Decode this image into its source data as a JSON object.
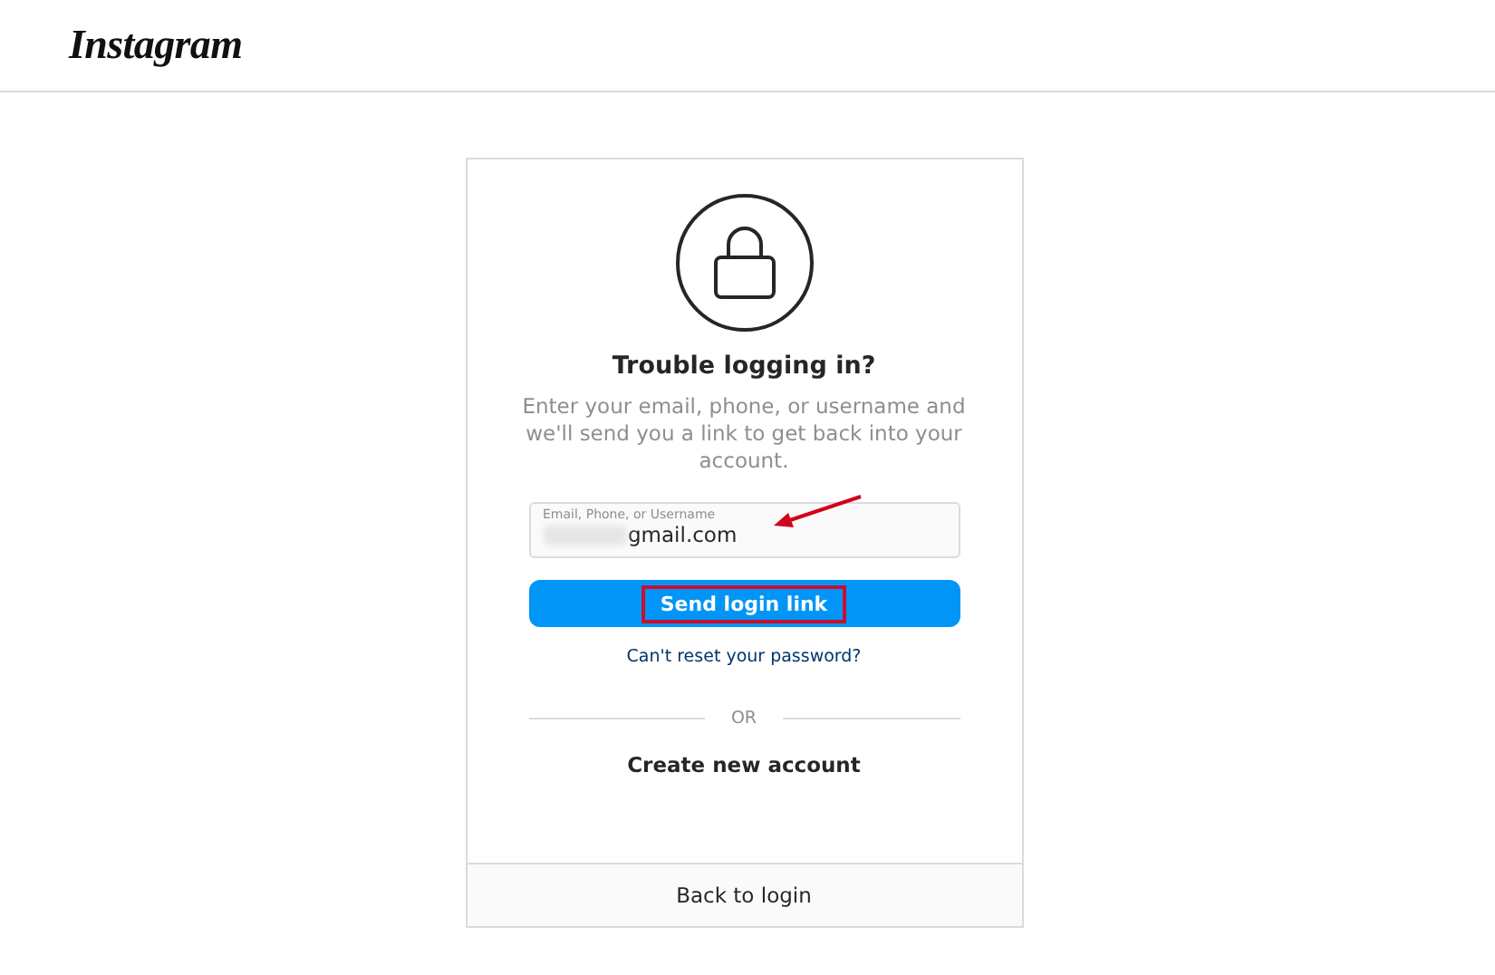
{
  "header": {
    "logo": "Instagram"
  },
  "card": {
    "title": "Trouble logging in?",
    "description": "Enter your email, phone, or username and we'll send you a link to get back into your account.",
    "field": {
      "label": "Email, Phone, or Username",
      "value": "gmail.com",
      "redacted": true
    },
    "send_button": {
      "label": "Send login link",
      "highlighted": true
    },
    "reset_link": "Can't reset your password?",
    "divider": "OR",
    "create_link": "Create new account",
    "back_link": "Back to login"
  }
}
